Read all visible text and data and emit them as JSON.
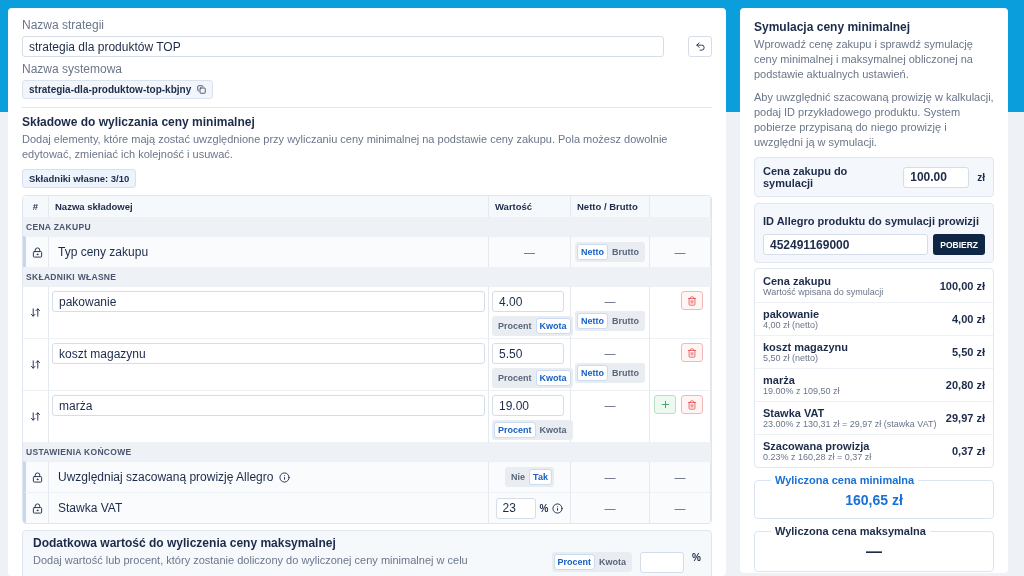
{
  "strategy_name": {
    "label": "Nazwa strategii",
    "value": "strategia dla produktów TOP"
  },
  "system_name": {
    "label": "Nazwa systemowa",
    "value": "strategia-dla-produktow-top-kbjny"
  },
  "components": {
    "title": "Składowe do wyliczania ceny minimalnej",
    "description": "Dodaj elementy, które mają zostać uwzględnione przy wyliczaniu ceny minimalnej na podstawie ceny zakupu. Pola możesz dowolnie edytować, zmieniać ich kolejność i usuwać.",
    "badge": "Składniki własne: 3/10"
  },
  "table": {
    "columns": [
      "#",
      "Nazwa składowej",
      "Wartość",
      "Netto / Brutto"
    ],
    "groups": [
      {
        "title": "CENA ZAKUPU",
        "rows": [
          {
            "kind": "locked",
            "name": "Typ ceny zakupu",
            "info": false,
            "value": {
              "text": "—"
            },
            "net": {
              "options": [
                {
                  "label": "Netto",
                  "selected": true
                },
                {
                  "label": "Brutto",
                  "selected": false
                }
              ]
            },
            "actions": {
              "text": "—"
            }
          }
        ]
      },
      {
        "title": "SKŁADNIKI WŁASNE",
        "rows": [
          {
            "kind": "custom",
            "name": "pakowanie",
            "value": {
              "value": "4.00",
              "options": [
                {
                  "label": "Procent",
                  "selected": false
                },
                {
                  "label": "Kwota",
                  "selected": true
                }
              ]
            },
            "net": {
              "text": "—",
              "options": [
                {
                  "label": "Netto",
                  "selected": true
                },
                {
                  "label": "Brutto",
                  "selected": false
                }
              ]
            },
            "actions": {
              "buttons": [
                {
                  "kind": "delete"
                }
              ]
            }
          },
          {
            "kind": "custom",
            "name": "koszt magazynu",
            "value": {
              "value": "5.50",
              "options": [
                {
                  "label": "Procent",
                  "selected": false
                },
                {
                  "label": "Kwota",
                  "selected": true
                }
              ]
            },
            "net": {
              "text": "—",
              "options": [
                {
                  "label": "Netto",
                  "selected": true
                },
                {
                  "label": "Brutto",
                  "selected": false
                }
              ]
            },
            "actions": {
              "buttons": [
                {
                  "kind": "delete"
                }
              ]
            }
          },
          {
            "kind": "custom",
            "name": "marża",
            "value": {
              "value": "19.00",
              "options": [
                {
                  "label": "Procent",
                  "selected": true
                },
                {
                  "label": "Kwota",
                  "selected": false
                }
              ]
            },
            "net": {
              "text": "—"
            },
            "actions": {
              "buttons": [
                {
                  "kind": "add"
                },
                {
                  "kind": "delete"
                }
              ]
            }
          }
        ]
      },
      {
        "title": "USTAWIENIA KOŃCOWE",
        "rows": [
          {
            "kind": "locked",
            "name": "Uwzględniaj szacowaną prowizję Allegro",
            "info": true,
            "value": {
              "options": [
                {
                  "label": "Nie",
                  "selected": false
                },
                {
                  "label": "Tak",
                  "selected": true
                }
              ]
            },
            "net": {
              "text": "—"
            },
            "actions": {
              "text": "—"
            }
          },
          {
            "kind": "locked",
            "name": "Stawka VAT",
            "info": false,
            "value": {
              "value": "23",
              "unit": "%",
              "info": true
            },
            "net": {
              "text": "—"
            },
            "actions": {
              "text": "—"
            }
          }
        ]
      }
    ]
  },
  "max_extra": {
    "title": "Dodatkowa wartość do wyliczenia ceny maksymalnej",
    "description": "Dodaj wartość lub procent, który zostanie doliczony do wyliczonej ceny minimalnej w celu",
    "options": [
      {
        "label": "Procent",
        "selected": true
      },
      {
        "label": "Kwota",
        "selected": false
      }
    ],
    "unit": "%"
  },
  "simulation": {
    "title": "Symulacja ceny minimalnej",
    "paragraphs": [
      "Wprowadź cenę zakupu i sprawdź symulację ceny minimalnej i maksymalnej obliczonej na podstawie aktualnych ustawień.",
      "Aby uwzględnić szacowaną prowizję w kalkulacji, podaj ID przykładowego produktu. System pobierze przypisaną do niego prowizję i uwzględni ją w symulacji."
    ],
    "purchase": {
      "label": "Cena zakupu do symulacji",
      "value": "100.00",
      "unit": "zł"
    },
    "product": {
      "label": "ID Allegro produktu do symulacji prowizji",
      "value": "452491169000",
      "button": "POBIERZ"
    },
    "breakdown": [
      {
        "name": "Cena zakupu",
        "detail": "Wartość wpisana do symulacji",
        "amount": "100,00 zł"
      },
      {
        "name": "pakowanie",
        "detail": "4,00 zł (netto)",
        "amount": "4,00 zł"
      },
      {
        "name": "koszt magazynu",
        "detail": "5,50 zł (netto)",
        "amount": "5,50 zł"
      },
      {
        "name": "marża",
        "detail": "19.00% z 109,50 zł",
        "amount": "20,80 zł"
      },
      {
        "name": "Stawka VAT",
        "detail": "23.00% z 130,31 zł = 29,97 zł (stawka VAT)",
        "amount": "29,97 zł"
      },
      {
        "name": "Szacowana prowizja",
        "detail": "0.23% z 160,28 zł = 0,37 zł",
        "amount": "0,37 zł"
      }
    ],
    "results": [
      {
        "label": "Wyliczona cena minimalna",
        "value": "160,65 zł",
        "highlighted": true
      },
      {
        "label": "Wyliczona cena maksymalna",
        "value": "—",
        "highlighted": false
      }
    ]
  }
}
